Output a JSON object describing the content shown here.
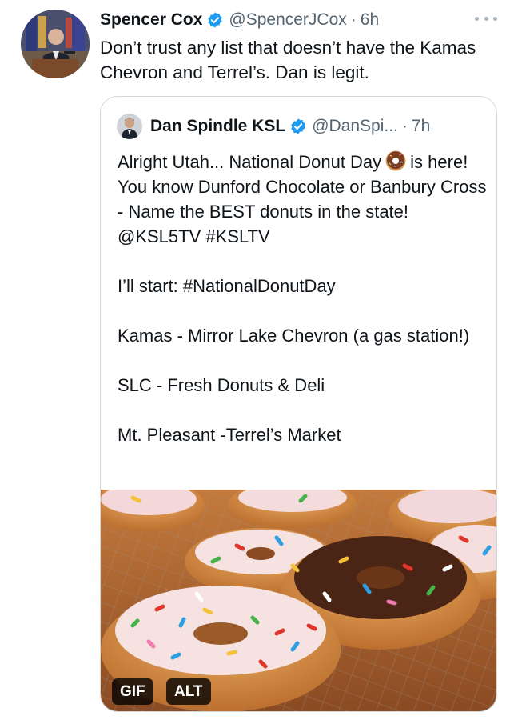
{
  "tweet": {
    "display_name": "Spencer Cox",
    "handle": "@SpencerJCox",
    "separator": "·",
    "time": "6h",
    "text": "Don’t trust any list that doesn’t have the Kamas Chevron and Terrel’s. Dan is legit.",
    "more_icon": "more-horizontal-icon"
  },
  "quoted": {
    "display_name": "Dan Spindle KSL",
    "handle": "@DanSpi...",
    "separator": "·",
    "time": "7h",
    "line1_before_emoji": "Alright Utah... National Donut Day",
    "line1_after_emoji": "is here! You know Dunford Chocolate or Banbury Cross - Name the BEST donuts in the state! @KSL5TV #KSLTV",
    "p2": "I’ll start: #NationalDonutDay",
    "p3": "Kamas - Mirror Lake Chevron (a gas station!)",
    "p4": "SLC - Fresh Donuts & Deli",
    "p5": "Mt. Pleasant -Terrel’s Market",
    "media": {
      "gif_label": "GIF",
      "alt_label": "ALT"
    }
  },
  "colors": {
    "text": "#0f1419",
    "secondary": "#536471",
    "verified": "#1d9bf0",
    "border": "#cfd9de"
  }
}
